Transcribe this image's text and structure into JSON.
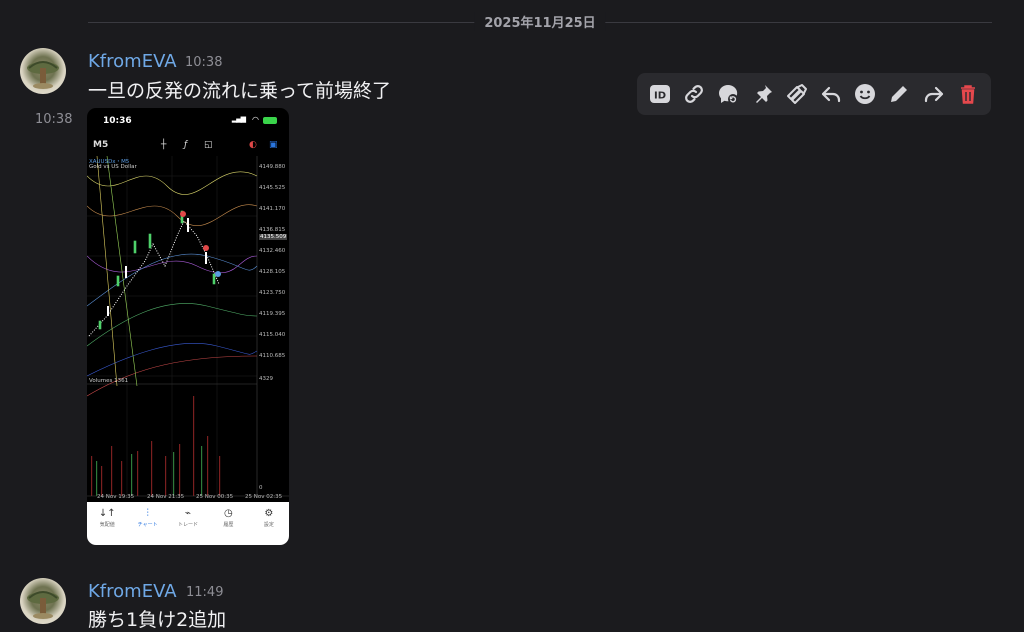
{
  "divider": {
    "date": "2025年11月25日"
  },
  "messages": [
    {
      "author": "KfromEVA",
      "time": "10:38",
      "text": "一旦の反発の流れに乗って前場終了",
      "attachment_time": "10:38"
    },
    {
      "author": "KfromEVA",
      "time": "11:49",
      "text": "勝ち1負け2追加"
    }
  ],
  "toolbar": {
    "icons": [
      "id-icon",
      "link-icon",
      "thread-icon",
      "pin-icon",
      "mark-unread-icon",
      "reply-icon",
      "emoji-icon",
      "edit-icon",
      "forward-icon",
      "delete-icon"
    ],
    "delete_color": "#e5484d"
  },
  "phone": {
    "clock": "10:36",
    "timeframe": "M5",
    "symbol": "XAUUSDx・M5",
    "symbol_desc": "Gold vs US Dollar",
    "price_labels": [
      "4149.880",
      "4145.525",
      "4141.170",
      "4136.815",
      "4135.509",
      "4132.460",
      "4128.105",
      "4123.750",
      "4119.395",
      "4115.040",
      "4110.685"
    ],
    "volume_label": "Volumes 1361",
    "volume_max": "4329",
    "volume_min": "0",
    "time_labels": [
      "24 Nov 19:35",
      "24 Nov 21:35",
      "25 Nov 00:35",
      "25 Nov 02:35"
    ],
    "nav": [
      {
        "label": "気配値",
        "icon": "↓↑"
      },
      {
        "label": "チャート",
        "icon": "⫶"
      },
      {
        "label": "トレード",
        "icon": "⌁"
      },
      {
        "label": "履歴",
        "icon": "◷"
      },
      {
        "label": "設定",
        "icon": "⚙"
      }
    ]
  },
  "colors": {
    "author": "#6fa8e6",
    "background": "#1b1b1e",
    "toolbar": "#2a2a2e"
  }
}
